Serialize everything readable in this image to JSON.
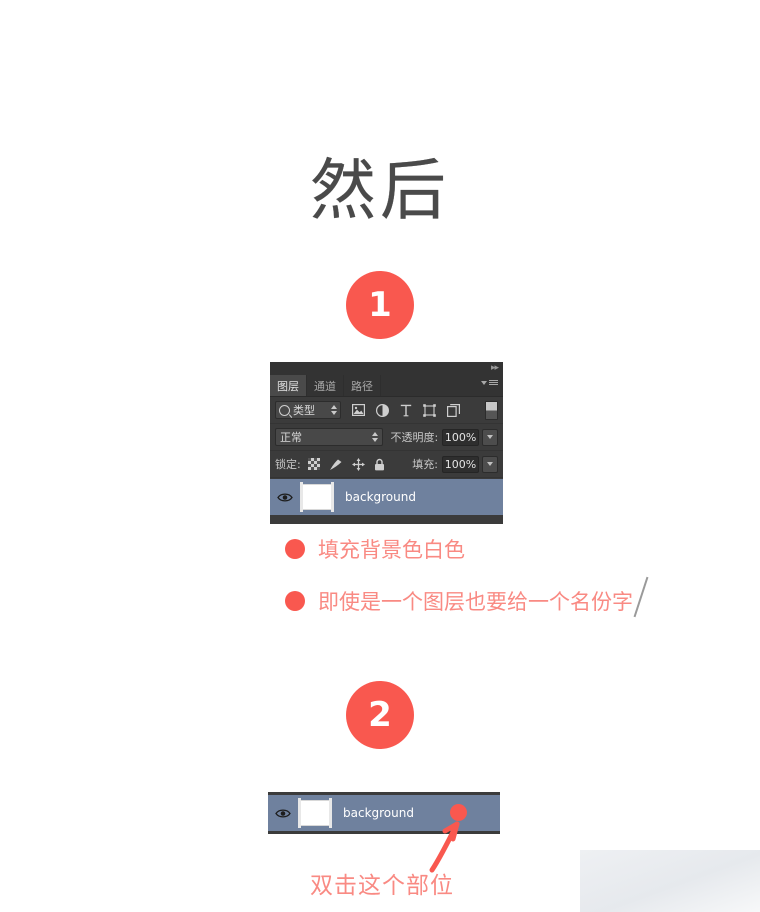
{
  "heading": {
    "text": "然后"
  },
  "steps": [
    {
      "number": "1"
    },
    {
      "number": "2"
    }
  ],
  "layers_panel": {
    "collapse_icon": "double-chevron-right-icon",
    "menu_icon": "panel-menu-icon",
    "tabs": [
      {
        "label": "图层",
        "active": true
      },
      {
        "label": "通道",
        "active": false
      },
      {
        "label": "路径",
        "active": false
      }
    ],
    "filter_row": {
      "kind_label": "类型",
      "search_icon": "search-icon",
      "filter_icons": [
        "pixel-layer-filter-icon",
        "adjustment-layer-filter-icon",
        "type-layer-filter-icon",
        "shape-layer-filter-icon",
        "smart-object-filter-icon"
      ],
      "toggle_icon": "filter-toggle-switch"
    },
    "blend_row": {
      "blend_mode": "正常",
      "opacity_label": "不透明度:",
      "opacity_value": "100%"
    },
    "lock_row": {
      "lock_label": "锁定:",
      "lock_icons": [
        "lock-transparent-pixels-icon",
        "lock-image-pixels-icon",
        "lock-position-icon",
        "lock-all-icon"
      ],
      "fill_label": "填充:",
      "fill_value": "100%"
    },
    "layers": [
      {
        "name": "background",
        "visibility_icon": "eye-icon",
        "thumbnail": "white-thumbnail",
        "selected": true
      }
    ]
  },
  "solo_layer_row": {
    "name": "background",
    "visibility_icon": "eye-icon",
    "thumbnail": "white-thumbnail",
    "marker_icon": "red-dot-marker"
  },
  "annotations": [
    {
      "bullet": "red-dot-bullet",
      "text": "填充背景色白色"
    },
    {
      "bullet": "red-dot-bullet",
      "text": "即使是一个图层也要给一个名份字"
    }
  ],
  "bottom_caption": {
    "text": "双击这个部位",
    "arrow_icon": "red-arrow-up-icon"
  },
  "colors": {
    "accent_red": "#f9584f",
    "annotation_text": "#f98a83",
    "panel_bg": "#3b3b3b",
    "panel_header_bg": "#333333",
    "layer_selected_bg": "#6f819e",
    "heading_text": "#4a4a4a"
  }
}
